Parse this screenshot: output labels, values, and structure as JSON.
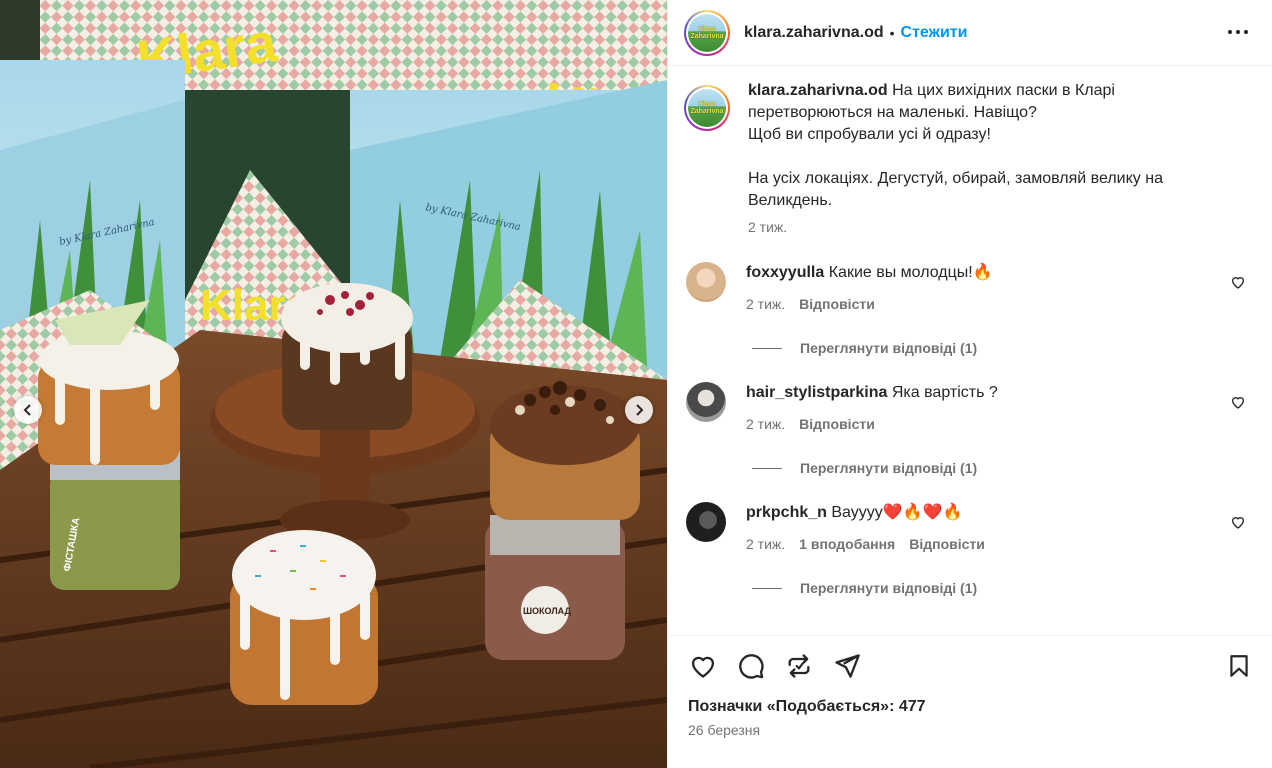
{
  "header": {
    "username": "klara.zaharivna.od",
    "separator": "•",
    "follow_label": "Стежити",
    "avatar_text": "Klara Zaharivna"
  },
  "media": {
    "brand_text": "Klara",
    "box_text": "by Klara Zaharivna",
    "jar_label_1": "ФІСТАШКА",
    "jar_label_2": "ШОКОЛАД"
  },
  "caption": {
    "username": "klara.zaharivna.od",
    "text": "На цих вихідних паски в Кларі перетворюються на маленькі. Навіщо?\nЩоб ви спробували усі й одразу!\n\nНа усіх локаціях. Дегустуй, обирай, замовляй велику на Великдень.",
    "time": "2 тиж."
  },
  "comments": [
    {
      "username": "foxxyyulla",
      "text": "Какие вы молодцы!🔥",
      "time": "2 тиж.",
      "likes": "",
      "reply_label": "Відповісти",
      "view_replies": "Переглянути відповіді (1)",
      "avatar_color": "#d9b38c"
    },
    {
      "username": "hair_stylistparkina",
      "text": "Яка вартість ?",
      "time": "2 тиж.",
      "likes": "",
      "reply_label": "Відповісти",
      "view_replies": "Переглянути відповіді (1)",
      "avatar_color": "#8a8a8a"
    },
    {
      "username": "prkpchk_n",
      "text": "Вауууу❤️🔥❤️🔥",
      "time": "2 тиж.",
      "likes": "1 вподобання",
      "reply_label": "Відповісти",
      "view_replies": "Переглянути відповіді (1)",
      "avatar_color": "#2b2b2b"
    }
  ],
  "footer": {
    "likes_text": "Позначки «Подобається»: 477",
    "date": "26 березня"
  },
  "icons": [
    "heart-icon",
    "comment-icon",
    "repost-icon",
    "share-icon",
    "bookmark-icon",
    "more-icon",
    "chevron-left-icon",
    "chevron-right-icon"
  ],
  "colors": {
    "link": "#0095f6",
    "muted": "#737373",
    "text": "#262626"
  }
}
